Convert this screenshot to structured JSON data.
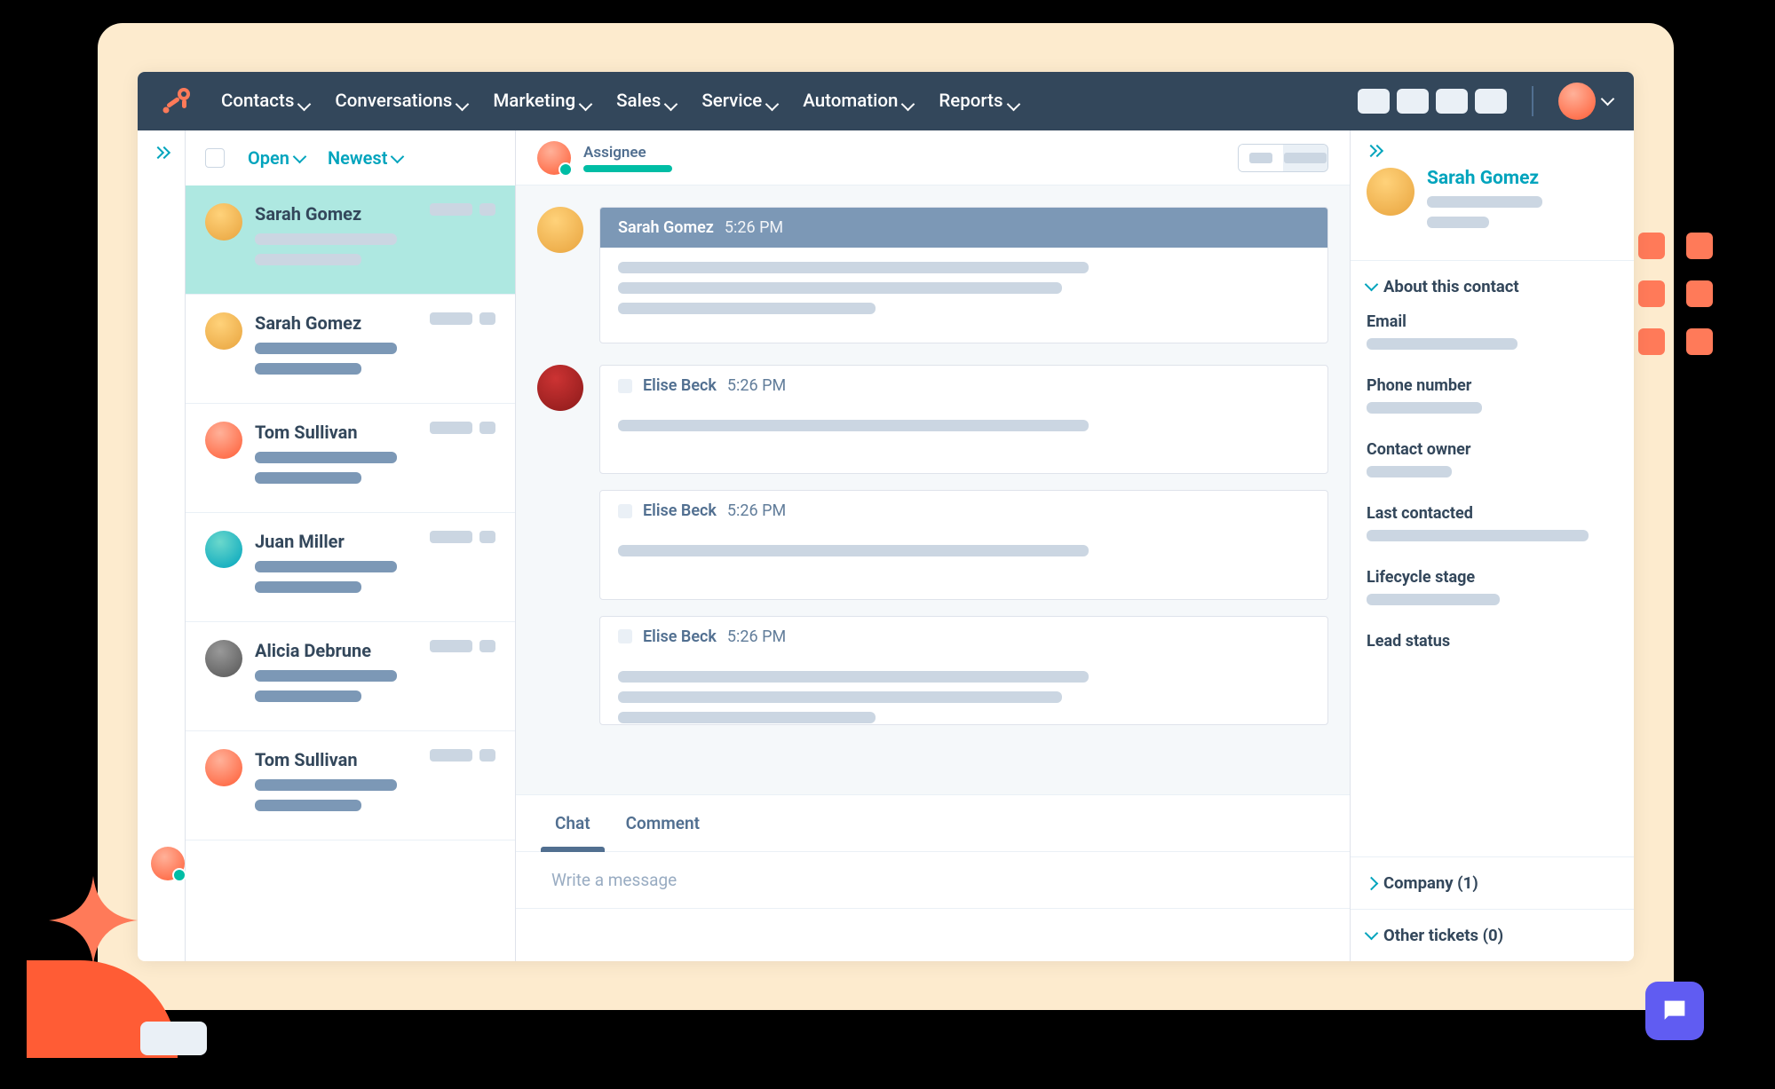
{
  "nav": {
    "items": [
      "Contacts",
      "Conversations",
      "Marketing",
      "Sales",
      "Service",
      "Automation",
      "Reports"
    ]
  },
  "filters": {
    "status": "Open",
    "sort": "Newest"
  },
  "conversations": [
    {
      "name": "Sarah Gomez",
      "active": true,
      "avatar": "av-yellow"
    },
    {
      "name": "Sarah Gomez",
      "active": false,
      "avatar": "av-yellow"
    },
    {
      "name": "Tom Sullivan",
      "active": false,
      "avatar": "av-orange"
    },
    {
      "name": "Juan Miller",
      "active": false,
      "avatar": "av-teal"
    },
    {
      "name": "Alicia Debrune",
      "active": false,
      "avatar": "av-gray"
    },
    {
      "name": "Tom Sullivan",
      "active": false,
      "avatar": "av-orange"
    }
  ],
  "thread": {
    "assignee_label": "Assignee",
    "messages": [
      {
        "author": "Sarah Gomez",
        "time": "5:26 PM",
        "primary": true,
        "avatar": "av-yellow",
        "lines": 3
      },
      {
        "author": "Elise Beck",
        "time": "5:26 PM",
        "primary": false,
        "avatar": "av-red",
        "lines": 1
      },
      {
        "author": "Elise Beck",
        "time": "5:26 PM",
        "primary": false,
        "avatar": "",
        "lines": 1
      },
      {
        "author": "Elise Beck",
        "time": "5:26 PM",
        "primary": false,
        "avatar": "",
        "lines": 3
      }
    ]
  },
  "composer": {
    "tabs": [
      "Chat",
      "Comment"
    ],
    "placeholder": "Write a message"
  },
  "contact": {
    "name": "Sarah Gomez",
    "about_label": "About this contact",
    "fields": [
      "Email",
      "Phone number",
      "Contact owner",
      "Last contacted",
      "Lifecycle stage",
      "Lead status"
    ],
    "company_label": "Company (1)",
    "tickets_label": "Other tickets (0)"
  }
}
